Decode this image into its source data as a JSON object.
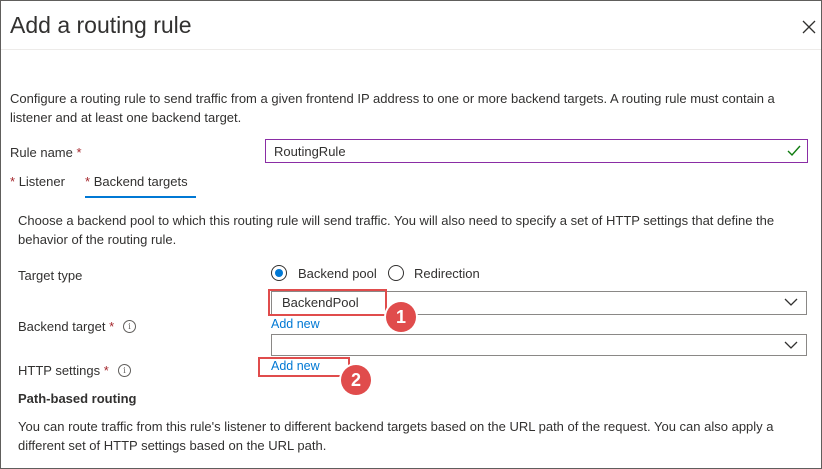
{
  "dialog": {
    "title": "Add a routing rule",
    "description": "Configure a routing rule to send traffic from a given frontend IP address to one or more backend targets. A routing rule must contain a listener and at least one backend target."
  },
  "rule_name": {
    "label": "Rule name",
    "required": "*",
    "value": "RoutingRule"
  },
  "tabs": [
    {
      "label": "Listener",
      "required": "*"
    },
    {
      "label": "Backend targets",
      "required": "*",
      "active": true
    }
  ],
  "backend": {
    "description": "Choose a backend pool to which this routing rule will send traffic. You will also need to specify a set of HTTP settings that define the behavior of the routing rule.",
    "target_type_label": "Target type",
    "options": [
      "Backend pool",
      "Redirection"
    ],
    "selected_option": "Backend pool",
    "backend_target_label": "Backend target",
    "backend_target_required": "*",
    "backend_target_value": "BackendPool",
    "backend_target_add_new": "Add new",
    "http_settings_label": "HTTP settings",
    "http_settings_required": "*",
    "http_settings_value": "",
    "http_settings_add_new": "Add new"
  },
  "path_routing": {
    "title": "Path-based routing",
    "description": "You can route traffic from this rule's listener to different backend targets based on the URL path of the request. You can also apply a different set of HTTP settings based on the URL path."
  },
  "annotations": {
    "badge_1": "1",
    "badge_2": "2"
  },
  "icons": [
    "close-icon",
    "checkmark-icon",
    "info-icon",
    "chevron-down-icon"
  ],
  "colors": {
    "accent": "#0078d4",
    "required": "#a4262c",
    "annotation": "#e04c4c",
    "valid_border": "#8a2da5",
    "valid_check": "#107c10"
  }
}
